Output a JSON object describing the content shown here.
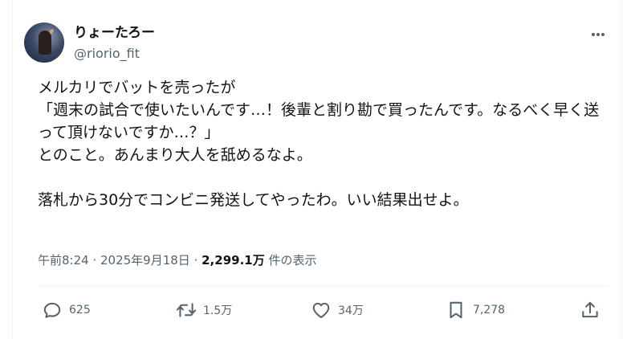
{
  "tweet": {
    "author": {
      "display_name": "りょーたろー",
      "handle": "@riorio_fit"
    },
    "text": "メルカリでバットを売ったが\n「週末の試合で使いたいんです…！後輩と割り勘で買ったんです。なるべく早く送って頂けないですか…？」\nとのこと。あんまり大人を舐めるなよ。\n\n落札から30分でコンビニ発送してやったわ。いい結果出せよ。",
    "meta": {
      "time": "午前8:24",
      "separator1": " · ",
      "date": "2025年9月18日",
      "separator2": " · ",
      "views_count": "2,299.1万",
      "views_label": " 件の表示"
    },
    "actions": {
      "replies": "625",
      "retweets": "1.5万",
      "likes": "34万",
      "bookmarks": "7,278"
    }
  },
  "icons": {
    "more": "more-horizontal-icon",
    "reply": "reply-icon",
    "retweet": "retweet-icon",
    "like": "heart-icon",
    "bookmark": "bookmark-icon",
    "share": "share-icon"
  },
  "colors": {
    "text_primary": "#0f1419",
    "text_secondary": "#536471",
    "divider": "#eff3f4"
  }
}
